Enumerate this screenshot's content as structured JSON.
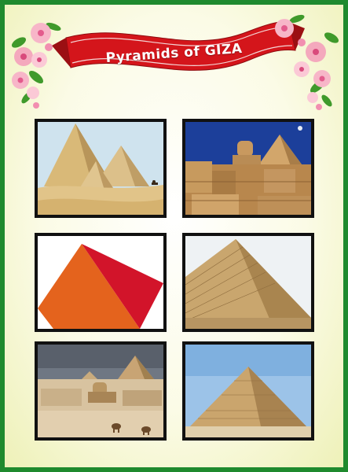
{
  "poster": {
    "title": "Pyramids of GIZA",
    "colors": {
      "border": "#1f8a2e",
      "ribbon": "#d4151b",
      "background": "#fbfbe6",
      "frame": "#111111"
    }
  },
  "photos": [
    {
      "name": "photo-pyramids-desert",
      "subject": "Three pyramids of Giza in the desert"
    },
    {
      "name": "photo-sphinx-pyramid",
      "subject": "Great Sphinx in front of a pyramid"
    },
    {
      "name": "photo-pyramid-illustration",
      "subject": "Orange pyramid illustration"
    },
    {
      "name": "photo-great-pyramid-closeup",
      "subject": "Close-up of the Great Pyramid"
    },
    {
      "name": "photo-giza-plateau-camels",
      "subject": "Giza plateau with Sphinx and camels"
    },
    {
      "name": "photo-great-pyramid-front",
      "subject": "Great Pyramid under a clear sky"
    }
  ]
}
